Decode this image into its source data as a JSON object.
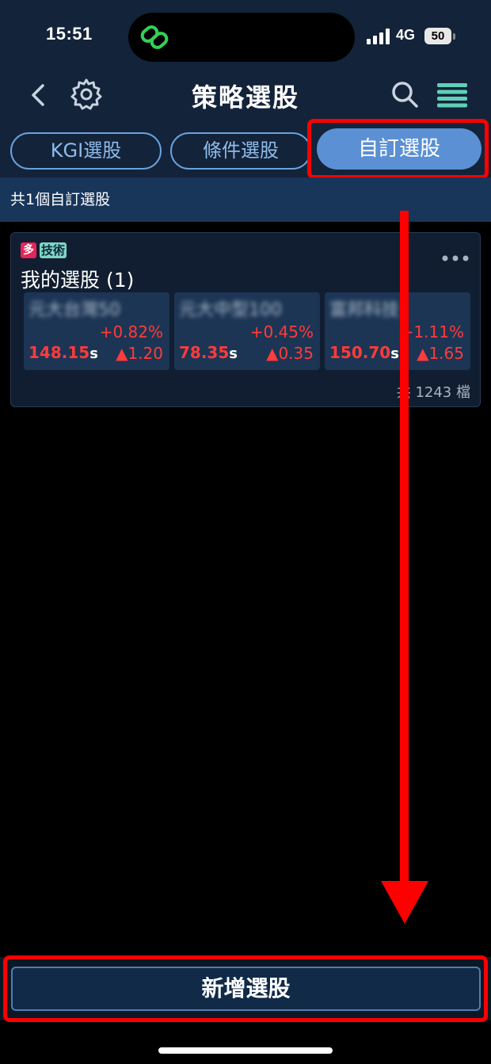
{
  "status_bar": {
    "time": "15:51",
    "network": "4G",
    "battery": "50",
    "island_icon": "link-icon"
  },
  "nav": {
    "title": "策略選股",
    "back_icon": "chevron-left-icon",
    "settings_icon": "gear-icon",
    "search_icon": "search-icon",
    "menu_icon": "menu-icon"
  },
  "tabs": [
    {
      "label": "KGI選股",
      "active": false
    },
    {
      "label": "條件選股",
      "active": false
    },
    {
      "label": "自訂選股",
      "active": true
    }
  ],
  "summary": "共1個自訂選股",
  "card": {
    "tag_multi": "多",
    "tag_tech": "技術",
    "title": "我的選股 (1)",
    "count": "共 1243 檔",
    "stocks": [
      {
        "name": "元大台灣50",
        "pct": "+0.82%",
        "price": "148.15",
        "suffix": "s",
        "change": "▲1.20"
      },
      {
        "name": "元大中型100",
        "pct": "+0.45%",
        "price": "78.35",
        "suffix": "s",
        "change": "▲0.35"
      },
      {
        "name": "富邦科技",
        "pct": "+1.11%",
        "price": "150.70",
        "suffix": "s",
        "change": "▲1.65"
      }
    ]
  },
  "add_button": "新增選股",
  "colors": {
    "header_bg": "#13233a",
    "accent": "#5b90d4",
    "up_red": "#ff3b3b",
    "highlight": "#ff0000"
  }
}
